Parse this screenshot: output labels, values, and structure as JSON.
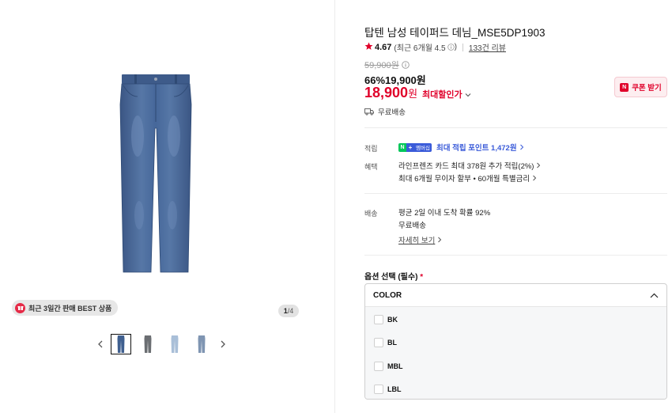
{
  "gallery": {
    "best_badge": "최근 3일간 판매 BEST 상품",
    "counter_current": "1",
    "counter_total": "/4",
    "thumbnails": [
      "dark-blue-jeans",
      "gray-jeans",
      "light-blue-jeans",
      "medium-blue-jeans"
    ]
  },
  "product": {
    "title": "탑텐 남성 테이퍼드 데님_MSE5DP1903",
    "rating": "4.67",
    "rating_recent": "(최근 6개월 4.5",
    "reviews": "133건 리뷰",
    "original_price": "59,900원",
    "discount_line": "66%19,900원",
    "max_price": "18,900",
    "max_unit": "원",
    "max_label": "최대할인가",
    "coupon_label": "쿠폰 받기",
    "shipping_short": "무료배송"
  },
  "benefits": {
    "points_label": "적립",
    "npay_text": "멤버십",
    "points_text": "최대 적립 포인트 1,472원",
    "benefit_label": "혜택",
    "benefit_1": "라인프렌즈 카드 최대 378원 추가 적립(2%)",
    "benefit_2": "최대 6개월 무이자 할부 • 60개월 특별금리"
  },
  "delivery": {
    "label": "배송",
    "line_1": "평균 2일 이내 도착 확률 92%",
    "line_2": "무료배송",
    "details_link": "자세히 보기"
  },
  "options": {
    "label": "옵션 선택 (필수)",
    "required_mark": "*",
    "select_title": "COLOR",
    "items": [
      {
        "label": "BK"
      },
      {
        "label": "BL"
      },
      {
        "label": "MBL"
      },
      {
        "label": "LBL"
      }
    ]
  },
  "colors": {
    "accent": "#e0002a",
    "points_blue": "#3a5bd9",
    "denim_dark": "#3f5f8f",
    "denim_mid": "#4d6f9f"
  }
}
